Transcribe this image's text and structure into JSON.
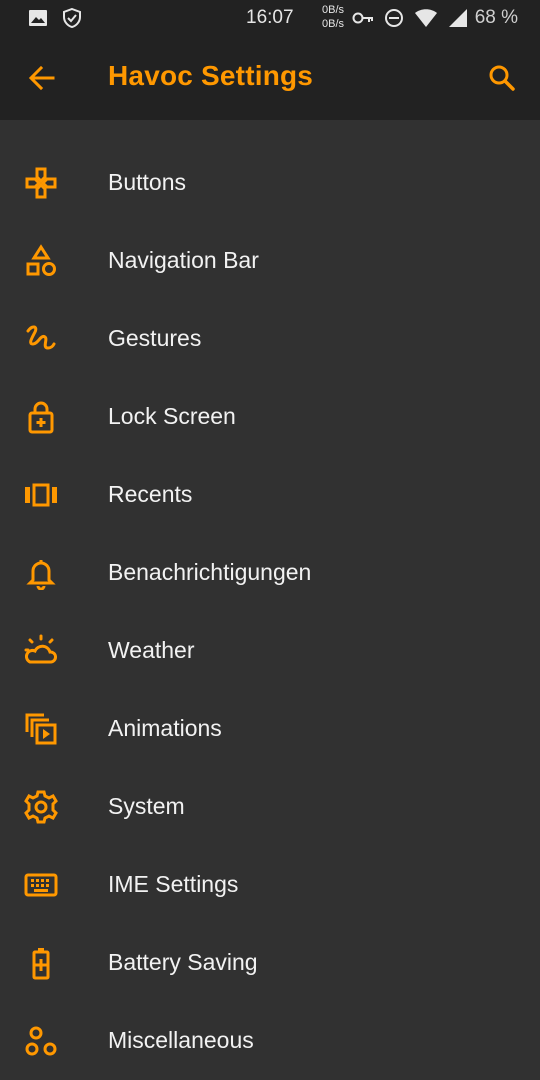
{
  "status_bar": {
    "time": "16:07",
    "net_up": "0B/s",
    "net_down": "0B/s",
    "battery": "68 %"
  },
  "app_bar": {
    "title": "Havoc Settings"
  },
  "menu": {
    "items": [
      {
        "label": "Buttons",
        "icon": "gamepad-icon"
      },
      {
        "label": "Navigation Bar",
        "icon": "shapes-icon"
      },
      {
        "label": "Gestures",
        "icon": "gesture-icon"
      },
      {
        "label": "Lock Screen",
        "icon": "lock-plus-icon"
      },
      {
        "label": "Recents",
        "icon": "recents-icon"
      },
      {
        "label": "Benachrichtigungen",
        "icon": "bell-icon"
      },
      {
        "label": "Weather",
        "icon": "weather-icon"
      },
      {
        "label": "Animations",
        "icon": "animations-icon"
      },
      {
        "label": "System",
        "icon": "gear-icon"
      },
      {
        "label": "IME Settings",
        "icon": "keyboard-icon"
      },
      {
        "label": "Battery Saving",
        "icon": "battery-plus-icon"
      },
      {
        "label": "Miscellaneous",
        "icon": "circles-icon"
      }
    ]
  },
  "colors": {
    "accent": "#ff9800",
    "background": "#313131",
    "bar": "#222222",
    "text": "#f2f2f2"
  }
}
